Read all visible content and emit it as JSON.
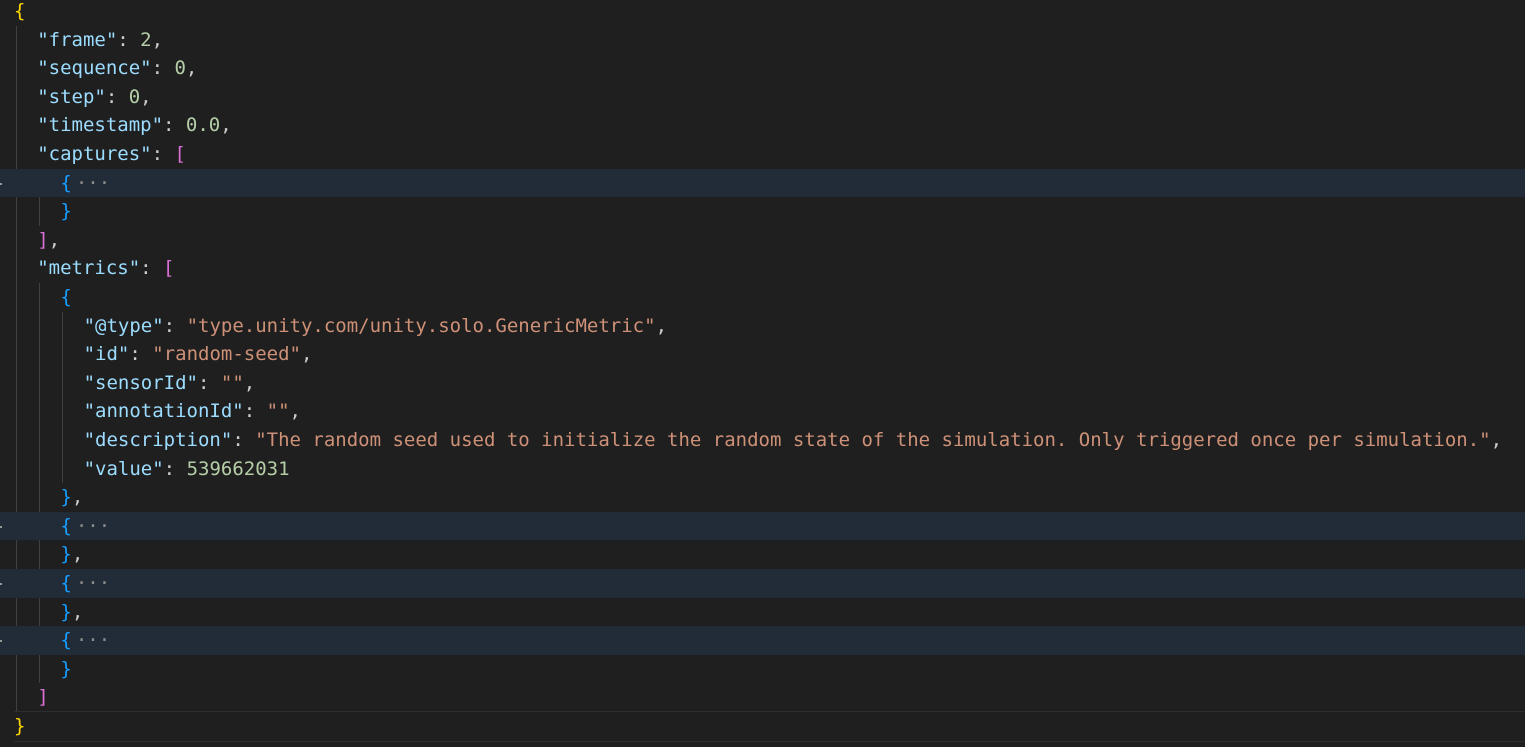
{
  "editor": {
    "language": "json",
    "lines": [
      {
        "indent": 0,
        "tokens": [
          {
            "t": "{",
            "c": "b1"
          }
        ]
      },
      {
        "indent": 1,
        "tokens": [
          {
            "t": "\"frame\"",
            "c": "k"
          },
          {
            "t": ": ",
            "c": "p"
          },
          {
            "t": "2",
            "c": "n"
          },
          {
            "t": ",",
            "c": "p"
          }
        ]
      },
      {
        "indent": 1,
        "tokens": [
          {
            "t": "\"sequence\"",
            "c": "k"
          },
          {
            "t": ": ",
            "c": "p"
          },
          {
            "t": "0",
            "c": "n"
          },
          {
            "t": ",",
            "c": "p"
          }
        ]
      },
      {
        "indent": 1,
        "tokens": [
          {
            "t": "\"step\"",
            "c": "k"
          },
          {
            "t": ": ",
            "c": "p"
          },
          {
            "t": "0",
            "c": "n"
          },
          {
            "t": ",",
            "c": "p"
          }
        ]
      },
      {
        "indent": 1,
        "tokens": [
          {
            "t": "\"timestamp\"",
            "c": "k"
          },
          {
            "t": ": ",
            "c": "p"
          },
          {
            "t": "0.0",
            "c": "n"
          },
          {
            "t": ",",
            "c": "p"
          }
        ]
      },
      {
        "indent": 1,
        "tokens": [
          {
            "t": "\"captures\"",
            "c": "k"
          },
          {
            "t": ": ",
            "c": "p"
          },
          {
            "t": "[",
            "c": "b2"
          }
        ]
      },
      {
        "indent": 2,
        "folded": true,
        "tokens": [
          {
            "t": "{",
            "c": "b3"
          }
        ]
      },
      {
        "indent": 2,
        "tokens": [
          {
            "t": "}",
            "c": "b3"
          }
        ]
      },
      {
        "indent": 1,
        "tokens": [
          {
            "t": "]",
            "c": "b2"
          },
          {
            "t": ",",
            "c": "p"
          }
        ]
      },
      {
        "indent": 1,
        "tokens": [
          {
            "t": "\"metrics\"",
            "c": "k"
          },
          {
            "t": ": ",
            "c": "p"
          },
          {
            "t": "[",
            "c": "b2"
          }
        ]
      },
      {
        "indent": 2,
        "tokens": [
          {
            "t": "{",
            "c": "b3"
          }
        ]
      },
      {
        "indent": 3,
        "tokens": [
          {
            "t": "\"@type\"",
            "c": "k"
          },
          {
            "t": ": ",
            "c": "p"
          },
          {
            "t": "\"type.unity.com/unity.solo.GenericMetric\"",
            "c": "s"
          },
          {
            "t": ",",
            "c": "p"
          }
        ]
      },
      {
        "indent": 3,
        "tokens": [
          {
            "t": "\"id\"",
            "c": "k"
          },
          {
            "t": ": ",
            "c": "p"
          },
          {
            "t": "\"random-seed\"",
            "c": "s"
          },
          {
            "t": ",",
            "c": "p"
          }
        ]
      },
      {
        "indent": 3,
        "tokens": [
          {
            "t": "\"sensorId\"",
            "c": "k"
          },
          {
            "t": ": ",
            "c": "p"
          },
          {
            "t": "\"\"",
            "c": "s"
          },
          {
            "t": ",",
            "c": "p"
          }
        ]
      },
      {
        "indent": 3,
        "tokens": [
          {
            "t": "\"annotationId\"",
            "c": "k"
          },
          {
            "t": ": ",
            "c": "p"
          },
          {
            "t": "\"\"",
            "c": "s"
          },
          {
            "t": ",",
            "c": "p"
          }
        ]
      },
      {
        "indent": 3,
        "tokens": [
          {
            "t": "\"description\"",
            "c": "k"
          },
          {
            "t": ": ",
            "c": "p"
          },
          {
            "t": "\"The random seed used to initialize the random state of the simulation. Only triggered once per simulation.\"",
            "c": "s"
          },
          {
            "t": ",",
            "c": "p"
          }
        ]
      },
      {
        "indent": 3,
        "tokens": [
          {
            "t": "\"value\"",
            "c": "k"
          },
          {
            "t": ": ",
            "c": "p"
          },
          {
            "t": "539662031",
            "c": "n"
          }
        ]
      },
      {
        "indent": 2,
        "tokens": [
          {
            "t": "}",
            "c": "b3"
          },
          {
            "t": ",",
            "c": "p"
          }
        ]
      },
      {
        "indent": 2,
        "folded": true,
        "tokens": [
          {
            "t": "{",
            "c": "b3"
          }
        ]
      },
      {
        "indent": 2,
        "tokens": [
          {
            "t": "}",
            "c": "b3"
          },
          {
            "t": ",",
            "c": "p"
          }
        ]
      },
      {
        "indent": 2,
        "folded": true,
        "tokens": [
          {
            "t": "{",
            "c": "b3"
          }
        ]
      },
      {
        "indent": 2,
        "tokens": [
          {
            "t": "}",
            "c": "b3"
          },
          {
            "t": ",",
            "c": "p"
          }
        ]
      },
      {
        "indent": 2,
        "folded": true,
        "tokens": [
          {
            "t": "{",
            "c": "b3"
          }
        ]
      },
      {
        "indent": 2,
        "tokens": [
          {
            "t": "}",
            "c": "b3"
          }
        ]
      },
      {
        "indent": 1,
        "tokens": [
          {
            "t": "]",
            "c": "b2"
          }
        ]
      },
      {
        "indent": 0,
        "tokens": [
          {
            "t": "}",
            "c": "b1"
          }
        ]
      }
    ],
    "fold_placeholder": "···"
  },
  "colors": {
    "background": "#1f1f1f",
    "folded_line_highlight": "#222c38",
    "key": "#9cdcfe",
    "string": "#ce9178",
    "number": "#b5cea8",
    "punctuation": "#cccccc",
    "bracket_level_1": "#ffd700",
    "bracket_level_2": "#da70d6",
    "bracket_level_3": "#179fff"
  }
}
